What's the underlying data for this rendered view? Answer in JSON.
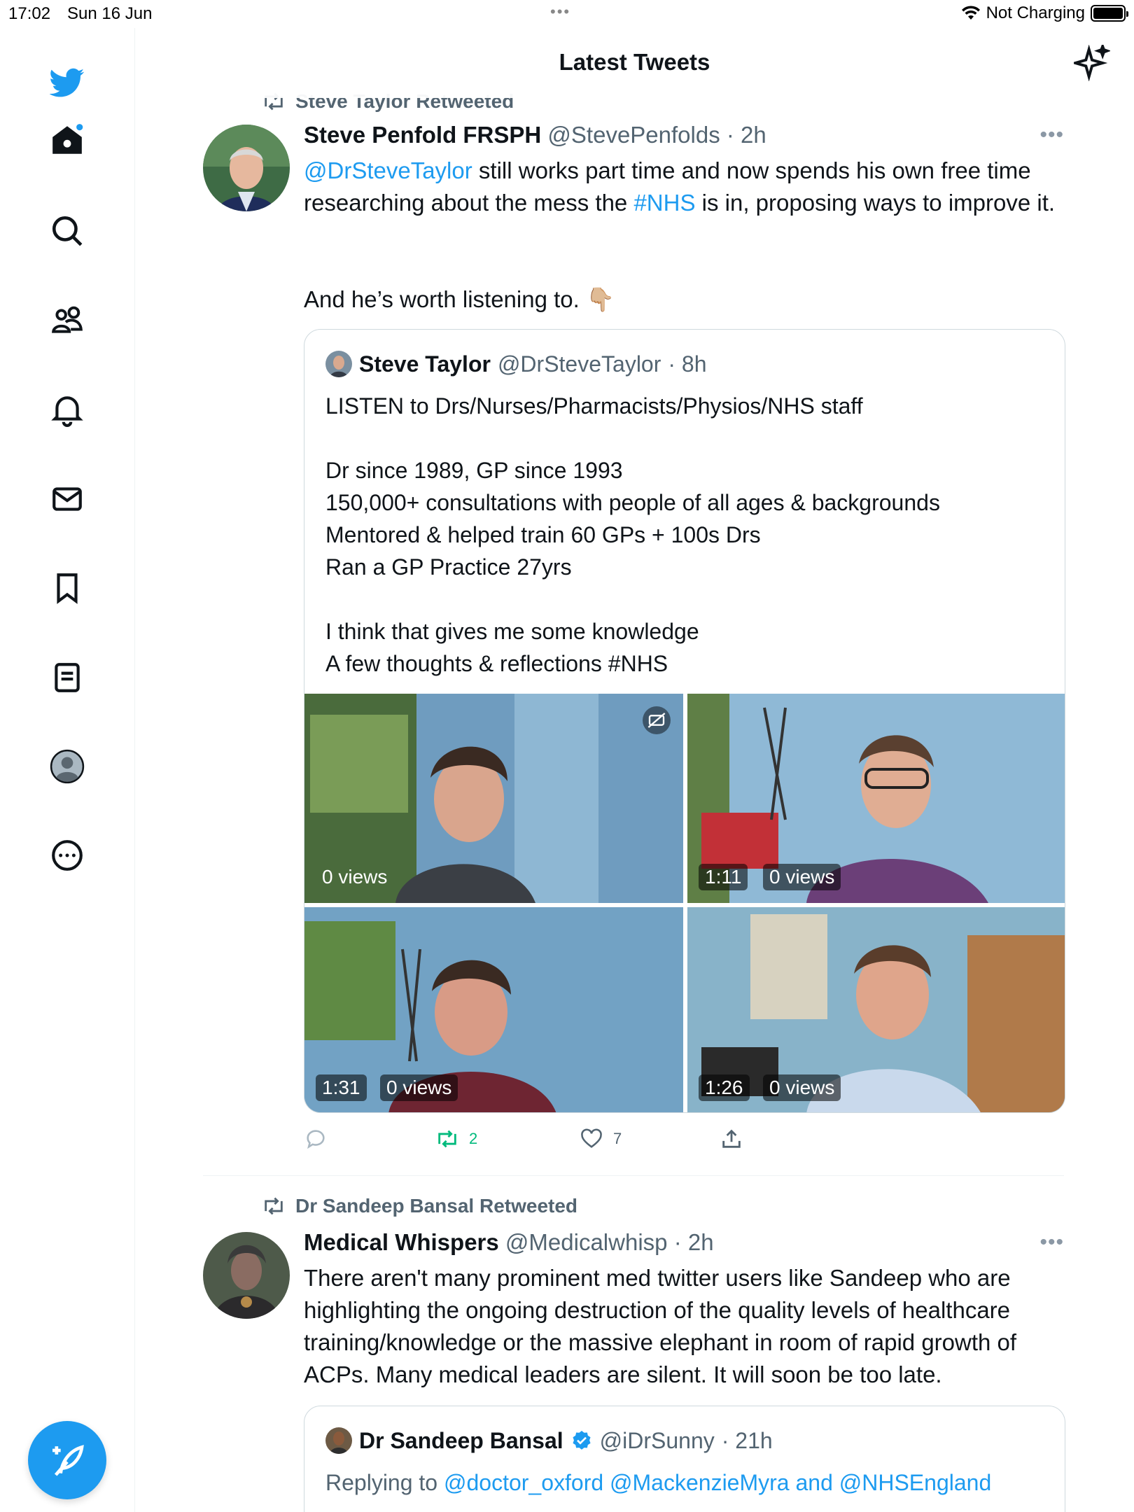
{
  "status_bar": {
    "time": "17:02",
    "date": "Sun 16 Jun",
    "battery_text": "Not Charging"
  },
  "header": {
    "title": "Latest Tweets"
  },
  "colors": {
    "accent": "#1d9bf0",
    "retweet_green": "#00ba7c",
    "muted": "#536471"
  },
  "sidebar": {
    "items": [
      {
        "name": "home",
        "icon": "home-icon"
      },
      {
        "name": "explore",
        "icon": "search-icon"
      },
      {
        "name": "communities",
        "icon": "communities-icon"
      },
      {
        "name": "notifications",
        "icon": "bell-icon"
      },
      {
        "name": "messages",
        "icon": "mail-icon"
      },
      {
        "name": "bookmarks",
        "icon": "bookmark-icon"
      },
      {
        "name": "lists",
        "icon": "list-icon"
      },
      {
        "name": "profile",
        "icon": "profile-icon"
      },
      {
        "name": "more",
        "icon": "more-circle-icon"
      }
    ],
    "compose_icon": "compose-feather-icon"
  },
  "tweet1": {
    "retweeted_by": "Steve Taylor Retweeted",
    "name": "Steve Penfold FRSPH",
    "handle": "@StevePenfolds",
    "time": "· 2h",
    "mention": "@DrSteveTaylor",
    "text_a": " still works part time and now spends his own free time researching about the mess the ",
    "hashtag": "#NHS",
    "text_b": " is in, proposing ways to improve it.",
    "text_c": "And he’s worth listening to. 👇🏼",
    "quote": {
      "name": "Steve Taylor",
      "handle": "@DrSteveTaylor",
      "time": "· 8h",
      "text": "LISTEN to Drs/Nurses/Pharmacists/Physios/NHS staff\n\nDr since 1989, GP since 1993\n150,000+ consultations with people of all ages & backgrounds\nMentored & helped train 60 GPs + 100s Drs\nRan a GP Practice 27yrs\n\nI think that gives me some knowledge\nA few thoughts & reflections #NHS",
      "videos": [
        {
          "duration": "",
          "views": "0 views"
        },
        {
          "duration": "1:11",
          "views": "0 views"
        },
        {
          "duration": "1:31",
          "views": "0 views"
        },
        {
          "duration": "1:26",
          "views": "0 views"
        }
      ]
    },
    "retweets": "2",
    "likes": "7"
  },
  "tweet2": {
    "retweeted_by": "Dr Sandeep Bansal Retweeted",
    "name": "Medical Whispers",
    "handle": "@Medicalwhisp",
    "time": "· 2h",
    "text": "There aren't many prominent med twitter users like Sandeep who are highlighting the ongoing destruction of the quality levels of healthcare training/knowledge or the massive elephant in room of rapid growth of ACPs. Many medical leaders are silent. It will soon be too late.",
    "quote": {
      "name": "Dr Sandeep Bansal",
      "handle": "@iDrSunny",
      "time": "· 21h",
      "replying_prefix": "Replying to ",
      "replying_to": "@doctor_oxford @MackenzieMyra and @NHSEngland"
    }
  }
}
